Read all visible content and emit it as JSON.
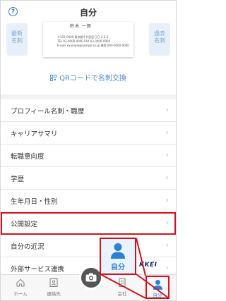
{
  "header": {
    "title": "自分",
    "help_icon": "question-circle-icon"
  },
  "card": {
    "left_side_label": "最新名刺",
    "right_side_label": "過去名刺",
    "name_text": "鈴木 一郎",
    "lines": [
      "〒101-0000 東京都千代田区〇〇 1-2-3",
      "TEL 03-0000-0000 FAX 03-0000-0000",
      "E-mail example@sample.co.jp 携帯 090-0000-0000"
    ]
  },
  "qr_link": "QRコードで名刺交換",
  "menu": [
    {
      "label": "プロフィール名刺・職歴",
      "highlight": false
    },
    {
      "label": "キャリアサマリ",
      "highlight": false
    },
    {
      "label": "転職意向度",
      "highlight": false
    },
    {
      "label": "学歴",
      "highlight": false
    },
    {
      "label": "生年月日・性別",
      "highlight": false
    },
    {
      "label": "公開設定",
      "highlight": true
    },
    {
      "label": "自分の近況",
      "highlight": false
    },
    {
      "label": "外部サービス連携",
      "highlight": false
    }
  ],
  "tabs": {
    "home": "ホーム",
    "contacts": "連絡先",
    "company": "会社",
    "me": "自分"
  },
  "zoom": {
    "label": "自分",
    "partial_brand": "KKEI"
  },
  "colors": {
    "accent": "#2f7fd4",
    "highlight": "#d3121f"
  }
}
